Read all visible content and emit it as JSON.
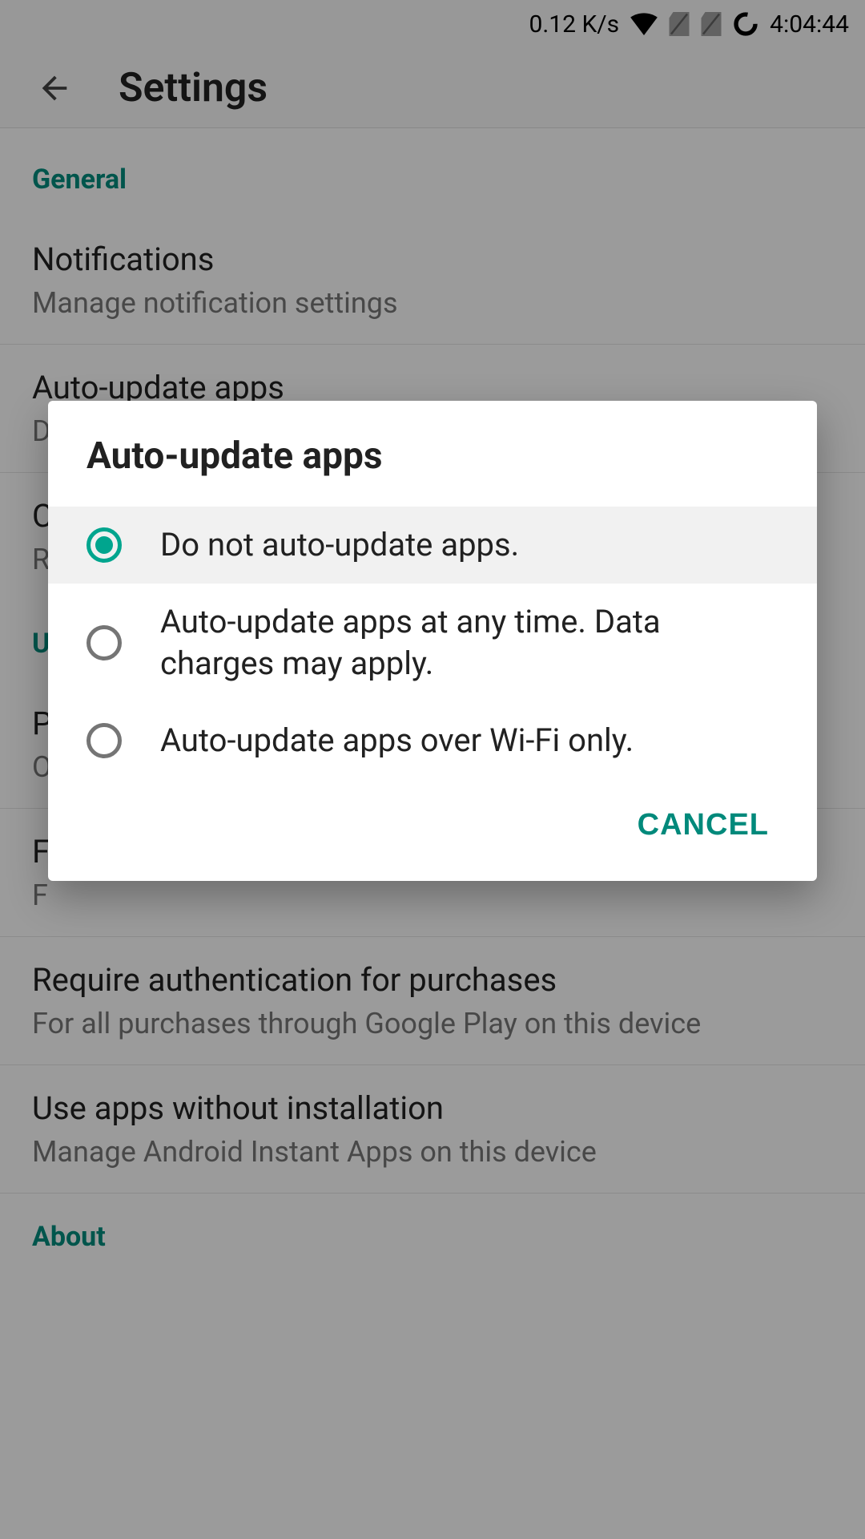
{
  "status_bar": {
    "speed": "0.12 K/s",
    "time": "4:04:44"
  },
  "app_bar": {
    "title": "Settings"
  },
  "sections": {
    "general_header": "General",
    "notifications": {
      "title": "Notifications",
      "sub": "Manage notification settings"
    },
    "auto_update": {
      "title": "Auto-update apps",
      "sub": "Do not auto-update apps."
    },
    "item3": {
      "title": "C",
      "sub": "R"
    },
    "user_header": "U",
    "item4": {
      "title": "P",
      "sub": "O"
    },
    "item5": {
      "title": "Fi",
      "sub": "F"
    },
    "require_auth": {
      "title": "Require authentication for purchases",
      "sub": "For all purchases through Google Play on this device"
    },
    "instant_apps": {
      "title": "Use apps without installation",
      "sub": "Manage Android Instant Apps on this device"
    },
    "about_header": "About"
  },
  "dialog": {
    "title": "Auto-update apps",
    "options": [
      "Do not auto-update apps.",
      "Auto-update apps at any time. Data charges may apply.",
      "Auto-update apps over Wi-Fi only."
    ],
    "cancel": "CANCEL",
    "selected_index": 0
  },
  "colors": {
    "accent": "#00897b"
  }
}
